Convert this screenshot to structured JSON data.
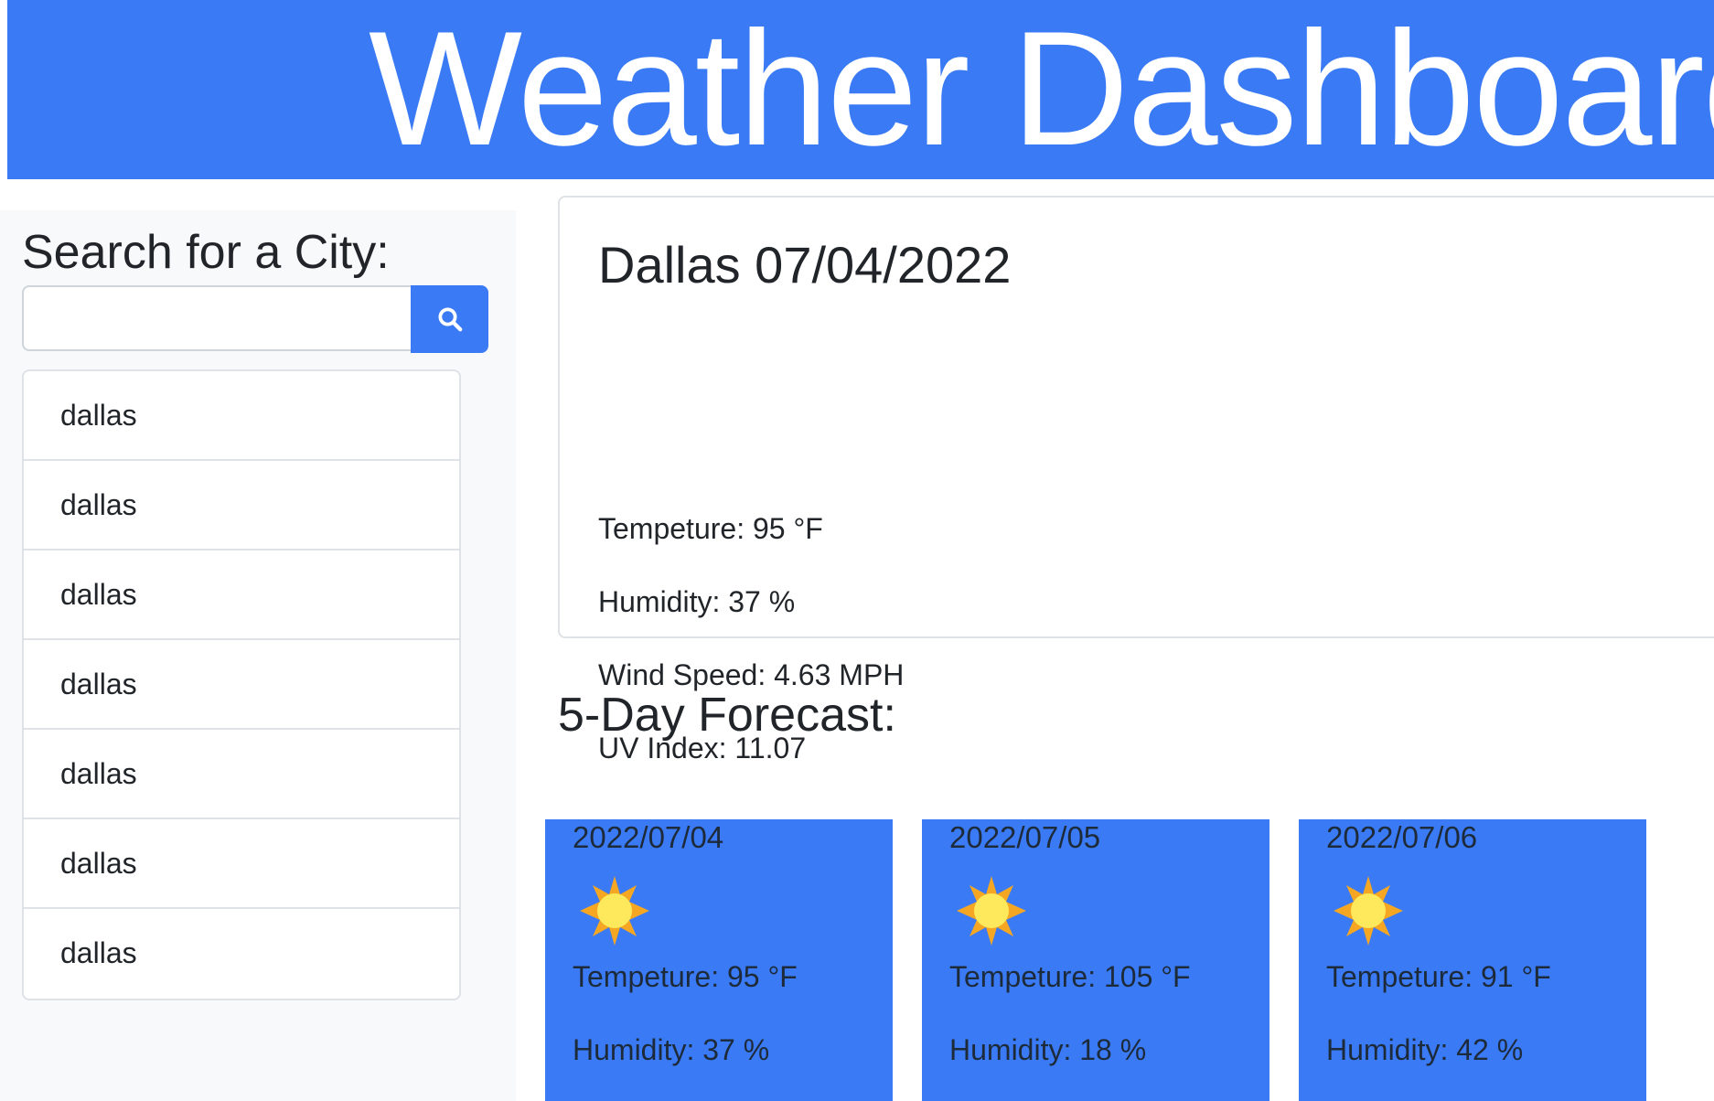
{
  "header": {
    "title": "Weather Dashboard"
  },
  "sidebar": {
    "heading": "Search for a City:",
    "search": {
      "value": "",
      "placeholder": "",
      "button_icon": "search-icon"
    },
    "history": [
      {
        "label": "dallas"
      },
      {
        "label": "dallas"
      },
      {
        "label": "dallas"
      },
      {
        "label": "dallas"
      },
      {
        "label": "dallas"
      },
      {
        "label": "dallas"
      },
      {
        "label": "dallas"
      }
    ]
  },
  "current": {
    "title": "Dallas 07/04/2022",
    "temperature": "Tempeture: 95 °F",
    "humidity": "Humidity: 37 %",
    "wind": "Wind Speed: 4.63 MPH",
    "uv": "UV Index: 11.07"
  },
  "forecast": {
    "heading": "5-Day Forecast:",
    "days": [
      {
        "date": "2022/07/04",
        "icon": "sun-icon",
        "temperature": "Tempeture: 95 °F",
        "humidity": "Humidity: 37 %"
      },
      {
        "date": "2022/07/05",
        "icon": "sun-icon",
        "temperature": "Tempeture: 105 °F",
        "humidity": "Humidity: 18 %"
      },
      {
        "date": "2022/07/06",
        "icon": "sun-icon",
        "temperature": "Tempeture: 91 °F",
        "humidity": "Humidity: 42 %"
      }
    ]
  },
  "colors": {
    "accent": "#3a7bf5",
    "sidebar_bg": "#f8f9fa",
    "sun_outer": "#f5a623",
    "sun_inner": "#fde95b"
  }
}
